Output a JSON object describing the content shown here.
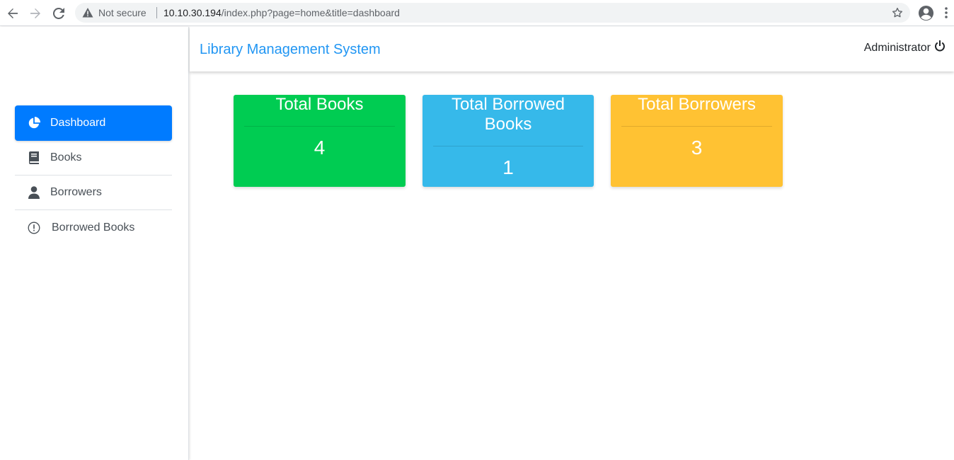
{
  "browser": {
    "security_label": "Not secure",
    "url_host": "10.10.30.194",
    "url_path": "/index.php?page=home&title=dashboard"
  },
  "header": {
    "app_title": "Library Management System",
    "user_name": "Administrator"
  },
  "sidebar": {
    "items": [
      {
        "label": "Dashboard",
        "icon": "pie-chart-icon",
        "active": true
      },
      {
        "label": "Books",
        "icon": "book-icon",
        "active": false
      },
      {
        "label": "Borrowers",
        "icon": "user-icon",
        "active": false
      },
      {
        "label": "Borrowed Books",
        "icon": "alert-circle-icon",
        "active": false
      }
    ]
  },
  "cards": [
    {
      "title": "Total Books",
      "value": "4",
      "color": "#00cc52"
    },
    {
      "title": "Total Borrowed Books",
      "value": "1",
      "color": "#36b9ea"
    },
    {
      "title": "Total Borrowers",
      "value": "3",
      "color": "#ffc233"
    }
  ],
  "colors": {
    "primary": "#007bff",
    "title_blue": "#2196f3"
  }
}
